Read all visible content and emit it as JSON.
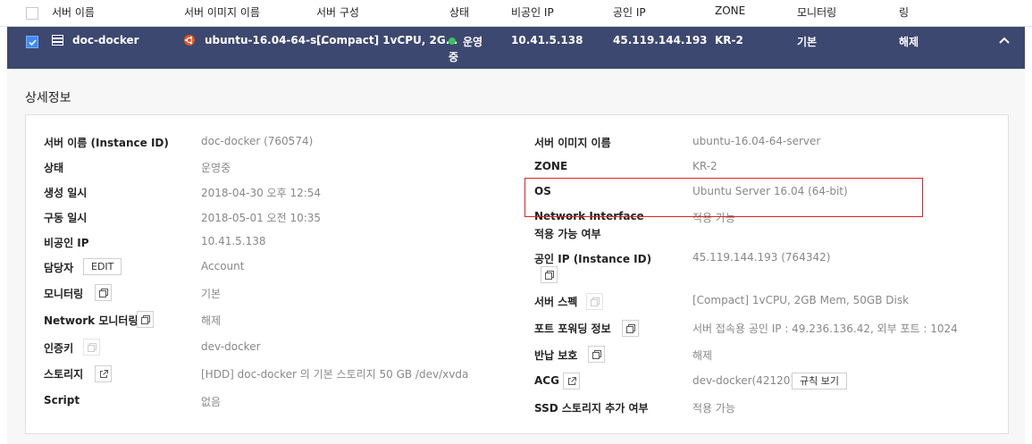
{
  "table": {
    "headers": [
      "서버 이름",
      "서버 이미지 이름",
      "서버 구성",
      "상태",
      "비공인 IP",
      "공인 IP",
      "ZONE",
      "모니터링",
      "링"
    ],
    "selected_row": {
      "server_name": "doc-docker",
      "image_name": "ubuntu-16.04-64-s...",
      "config": "[Compact] 1vCPU, 2G...",
      "status_line1": "운영",
      "status_line2": "중",
      "private_ip": "10.41.5.138",
      "public_ip": "45.119.144.193",
      "zone": "KR-2",
      "monitoring": "기본",
      "last_col": "해제"
    }
  },
  "detail": {
    "title": "상세정보",
    "left": [
      {
        "label": "서버 이름 (Instance ID)",
        "value": "doc-docker (760574)"
      },
      {
        "label": "상태",
        "value": "운영중"
      },
      {
        "label": "생성 일시",
        "value": "2018-04-30 오후 12:54"
      },
      {
        "label": "구동 일시",
        "value": "2018-05-01 오전 10:35"
      },
      {
        "label": "비공인 IP",
        "value": "10.41.5.138"
      },
      {
        "label": "담당자",
        "value": "Account",
        "button": "EDIT"
      },
      {
        "label": "모니터링",
        "value": "기본"
      },
      {
        "label": "Network 모니터링",
        "value": "해제"
      },
      {
        "label": "인증키",
        "value": "dev-docker"
      },
      {
        "label": "스토리지",
        "value": "[HDD] doc-docker 의 기본 스토리지  50 GB /dev/xvda"
      },
      {
        "label": "Script",
        "value": "없음"
      }
    ],
    "right": [
      {
        "label": "서버 이미지 이름",
        "value": "ubuntu-16.04-64-server"
      },
      {
        "label": "ZONE",
        "value": "KR-2"
      },
      {
        "label": "OS",
        "value": "Ubuntu Server 16.04 (64-bit)"
      },
      {
        "label": "Network Interface",
        "label2": "적용 가능 여부",
        "value": "적용 가능"
      },
      {
        "label": "공인 IP (Instance ID)",
        "value": "45.119.144.193 (764342)"
      },
      {
        "label": "서버 스펙",
        "value": "[Compact] 1vCPU, 2GB Mem, 50GB Disk"
      },
      {
        "label": "포트 포워딩 정보",
        "value": "서버 접속용 공인 IP : 49.236.136.42, 외부 포트 : 1024"
      },
      {
        "label": "반납 보호",
        "value": "해제"
      },
      {
        "label": "ACG",
        "value": "dev-docker(42120)",
        "button": "규칙 보기"
      },
      {
        "label": "SSD 스토리지 추가 여부",
        "value": "적용 가능"
      }
    ]
  },
  "colors": {
    "selected_row_bg": "#3d4870",
    "status_running": "#35c759",
    "highlight_border": "#dd2222",
    "ubuntu_icon": "#e95420"
  },
  "icons": [
    "checkbox",
    "server-icon",
    "ubuntu-icon",
    "chevron-up-icon",
    "copy-icon",
    "external-link-icon"
  ]
}
